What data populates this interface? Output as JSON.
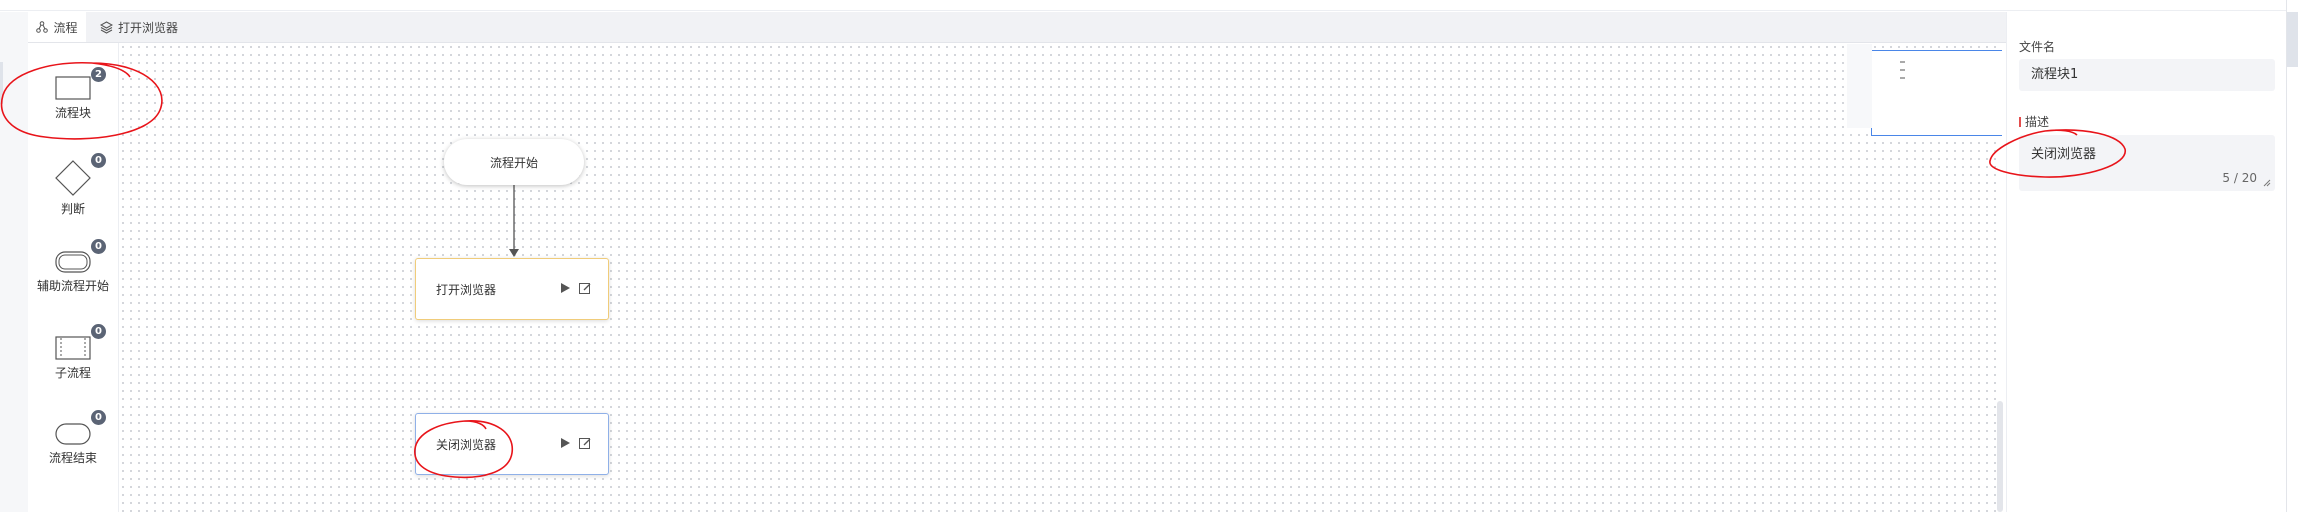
{
  "tabs": [
    {
      "label": "流程",
      "icon": "flow-icon",
      "active": true
    },
    {
      "label": "打开浏览器",
      "icon": "layers-icon",
      "active": false
    }
  ],
  "palette": [
    {
      "label": "流程块",
      "count": "2",
      "icon": "rectangle-icon"
    },
    {
      "label": "判断",
      "count": "0",
      "icon": "diamond-icon"
    },
    {
      "label": "辅助流程开始",
      "count": "0",
      "icon": "rounded-rect-icon"
    },
    {
      "label": "子流程",
      "count": "0",
      "icon": "dotted-rect-icon"
    },
    {
      "label": "流程结束",
      "count": "0",
      "icon": "pill-icon"
    }
  ],
  "canvas": {
    "start_node": "流程开始",
    "blocks": [
      {
        "label": "打开浏览器",
        "accent": "#f0cc7a"
      },
      {
        "label": "关闭浏览器",
        "accent": "#8fb0e8"
      }
    ]
  },
  "properties": {
    "filename_label": "文件名",
    "filename_value": "流程块1",
    "description_label": "描述",
    "description_value": "关闭浏览器",
    "description_counter": "5 / 20"
  },
  "colors": {
    "annotation": "#e8141a",
    "selected_block_border": "#8fb0e8",
    "active_block_border": "#f0cc7a",
    "minimap_border": "#4a86e8"
  }
}
